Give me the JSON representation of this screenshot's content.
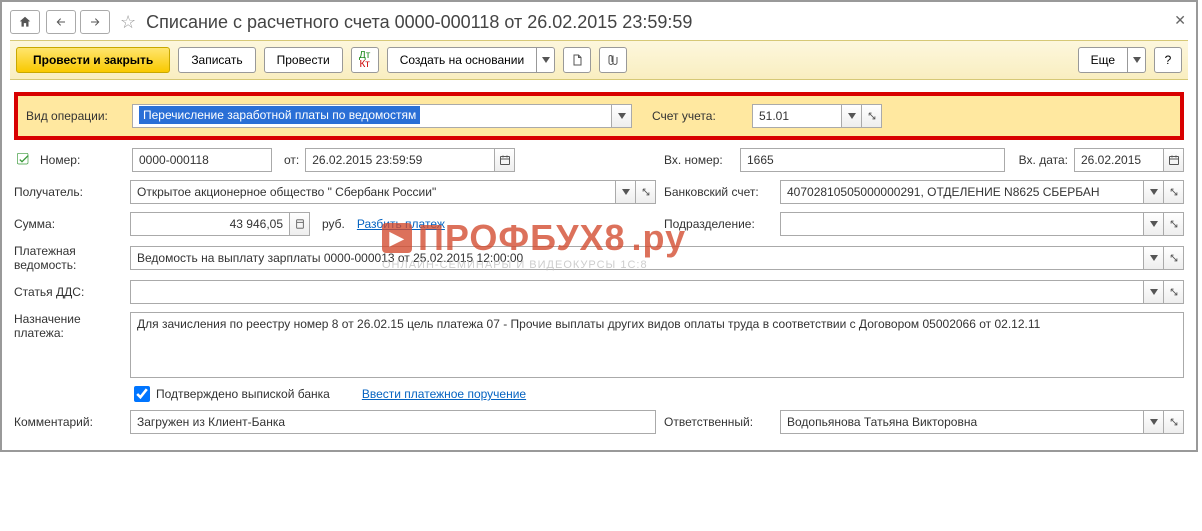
{
  "title": "Списание с расчетного счета 0000-000118 от 26.02.2015 23:59:59",
  "toolbar": {
    "post_close": "Провести и закрыть",
    "save": "Записать",
    "post": "Провести",
    "create_by": "Создать на основании",
    "more": "Еще"
  },
  "labels": {
    "op_type": "Вид операции:",
    "number": "Номер:",
    "from": "от:",
    "in_number": "Вх. номер:",
    "in_date": "Вх. дата:",
    "recipient": "Получатель:",
    "bank_acct": "Банковский счет:",
    "amount": "Сумма:",
    "currency": "руб.",
    "split": "Разбить платеж",
    "subdivision": "Подразделение:",
    "account": "Счет учета:",
    "pay_list": "Платежная ведомость:",
    "dds": "Статья ДДС:",
    "purpose": "Назначение платежа:",
    "confirmed": "Подтверждено выпиской банка",
    "enter_payorder": "Ввести платежное поручение",
    "comment": "Комментарий:",
    "responsible": "Ответственный:"
  },
  "values": {
    "op_type": "Перечисление заработной платы по ведомостям",
    "number": "0000-000118",
    "date": "26.02.2015 23:59:59",
    "in_number": "1665",
    "in_date": "26.02.2015",
    "recipient": "Открытое акционерное общество \" Сбербанк России\"",
    "bank_acct": "40702810505000000291, ОТДЕЛЕНИЕ N8625 СБЕРБАН",
    "amount": "43 946,05",
    "subdivision": "",
    "account": "51.01",
    "pay_list": "Ведомость на выплату зарплаты 0000-000013 от 25.02.2015 12:00:00",
    "dds": "",
    "purpose": "Для зачисления по реестру номер 8 от 26.02.15 цель платежа 07 - Прочие выплаты других видов оплаты труда в соответствии с Договором 05002066 от 02.12.11",
    "comment": "Загружен из Клиент-Банка",
    "responsible": "Водопьянова Татьяна Викторовна"
  },
  "watermark": {
    "main": "ПРОФБУХ8",
    "domain": ".ру",
    "sub": "ОНЛАЙН-СЕМИНАРЫ И ВИДЕОКУРСЫ 1С:8"
  }
}
